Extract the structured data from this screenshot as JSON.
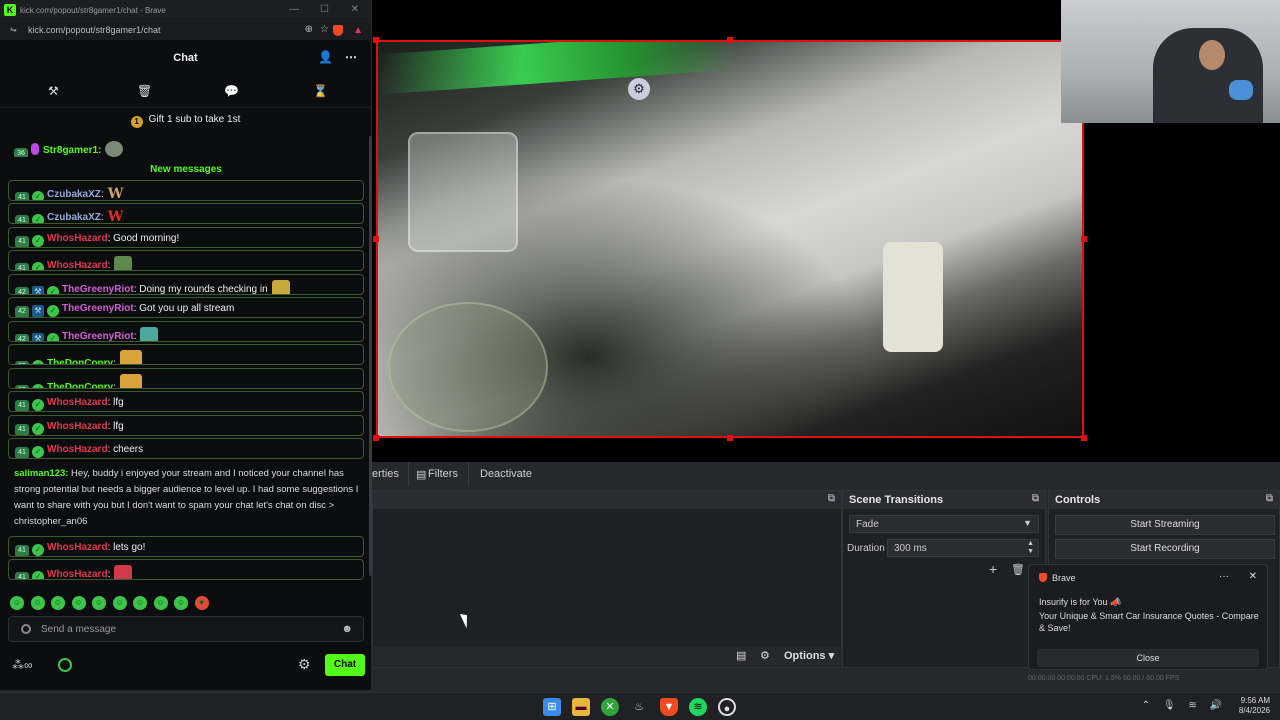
{
  "browser": {
    "title": "kick.com/popout/str8gamer1/chat - Brave",
    "url": "kick.com/popout/str8gamer1/chat"
  },
  "chat": {
    "header": "Chat",
    "pinned_text": "Gift 1 sub to take 1st",
    "pinned_count": "1",
    "first_message": {
      "badge": "36",
      "user": "Str8gamer1:"
    },
    "new_messages_label": "New messages",
    "messages": [
      {
        "badge": "41",
        "user": "CzubakaXZ",
        "text": "",
        "emote": "W",
        "user_color": "#9aa9d9"
      },
      {
        "badge": "41",
        "user": "CzubakaXZ",
        "text": "",
        "emote": "W",
        "user_color": "#9aa9d9"
      },
      {
        "badge": "41",
        "user": "WhosHazard",
        "text": ": Good morning!",
        "emote": "",
        "user_color": "#e0384f"
      },
      {
        "badge": "41",
        "user": "WhosHazard",
        "text": ":",
        "emote": "frog",
        "user_color": "#e0384f"
      },
      {
        "badge": "42",
        "user": "TheGreenyRiot",
        "text": ": Doing my rounds checking in",
        "emote": "group",
        "user_color": "#d05fd3"
      },
      {
        "badge": "42",
        "user": "TheGreenyRiot",
        "text": ": Got you up all stream",
        "emote": "",
        "user_color": "#d05fd3"
      },
      {
        "badge": "42",
        "user": "TheGreenyRiot",
        "text": ":",
        "emote": "bot",
        "user_color": "#d05fd3"
      },
      {
        "badge": "39",
        "user": "TheDonConry",
        "text": ":",
        "emote": "gold",
        "user_color": "#53fc18"
      },
      {
        "badge": "39",
        "user": "TheDonConry",
        "text": ":",
        "emote": "gold",
        "user_color": "#53fc18"
      },
      {
        "badge": "41",
        "user": "WhosHazard",
        "text": ": lfg",
        "emote": "",
        "user_color": "#e0384f"
      },
      {
        "badge": "41",
        "user": "WhosHazard",
        "text": ": lfg",
        "emote": "",
        "user_color": "#e0384f"
      },
      {
        "badge": "41",
        "user": "WhosHazard",
        "text": ": cheers",
        "emote": "",
        "user_color": "#e0384f"
      }
    ],
    "long_message": {
      "user": "saliman123:",
      "text": "Hey, buddy i enjoyed your stream and I noticed your channel has strong potential but needs a bigger audience to level up. I had some suggestions I want to share with you but I don't want to spam your chat let's chat on disc > christopher_an06"
    },
    "after_messages": [
      {
        "badge": "41",
        "user": "WhosHazard",
        "text": ": lets go!",
        "emote": ""
      },
      {
        "badge": "41",
        "user": "WhosHazard",
        "text": ":",
        "emote": "cup"
      }
    ],
    "input_placeholder": "Send a message",
    "send_label": "Chat",
    "points_symbol": "∞"
  },
  "obs": {
    "toolbar": {
      "properties": "erties",
      "filters": "Filters",
      "deactivate": "Deactivate"
    },
    "scene_transitions": {
      "title": "Scene Transitions",
      "transition": "Fade",
      "duration_label": "Duration",
      "duration_value": "300 ms"
    },
    "controls": {
      "title": "Controls",
      "start_streaming": "Start Streaming",
      "start_recording": "Start Recording"
    },
    "options_label": "Options",
    "status_text": "00:00:00   00:00:00   CPU: 1.5%   60.00 / 60.00 FPS"
  },
  "notification": {
    "brand": "Brave",
    "title": "Insurify is for You",
    "body": "Your Unique & Smart Car Insurance Quotes - Compare & Save!",
    "close_label": "Close"
  },
  "taskbar": {
    "time": "9:56 AM",
    "date": "8/4/2026"
  },
  "colors": {
    "kick_green": "#53fc18",
    "selection_red": "#e01010",
    "brave_orange": "#f04a23"
  }
}
